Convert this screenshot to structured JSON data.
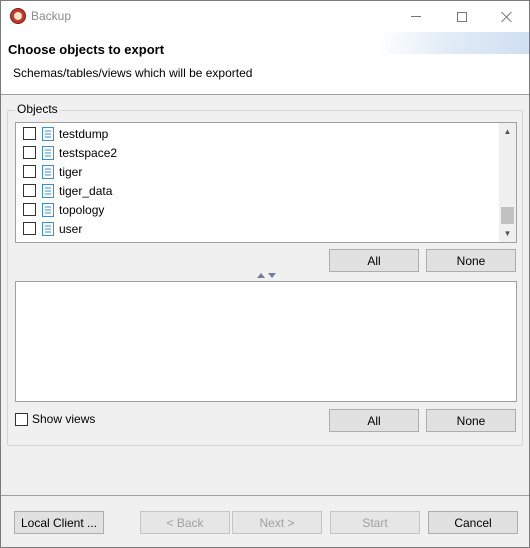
{
  "window": {
    "title": "Backup",
    "app_icon": "backup-app-icon"
  },
  "header": {
    "title": "Choose objects to export",
    "subtitle": "Schemas/tables/views which will be exported"
  },
  "objects": {
    "group_label": "Objects",
    "items": [
      {
        "label": "testdump",
        "checked": false
      },
      {
        "label": "testspace2",
        "checked": false
      },
      {
        "label": "tiger",
        "checked": false
      },
      {
        "label": "tiger_data",
        "checked": false
      },
      {
        "label": "topology",
        "checked": false
      },
      {
        "label": "user",
        "checked": false
      }
    ],
    "all_label": "All",
    "none_label": "None"
  },
  "details": {
    "show_views_label": "Show views",
    "all_label": "All",
    "none_label": "None"
  },
  "footer": {
    "local_client_label": "Local Client ...",
    "back_label": "< Back",
    "next_label": "Next >",
    "start_label": "Start",
    "cancel_label": "Cancel"
  },
  "colors": {
    "schema_icon": "#3a8fd6",
    "disabled_text": "#a0a0a0"
  }
}
